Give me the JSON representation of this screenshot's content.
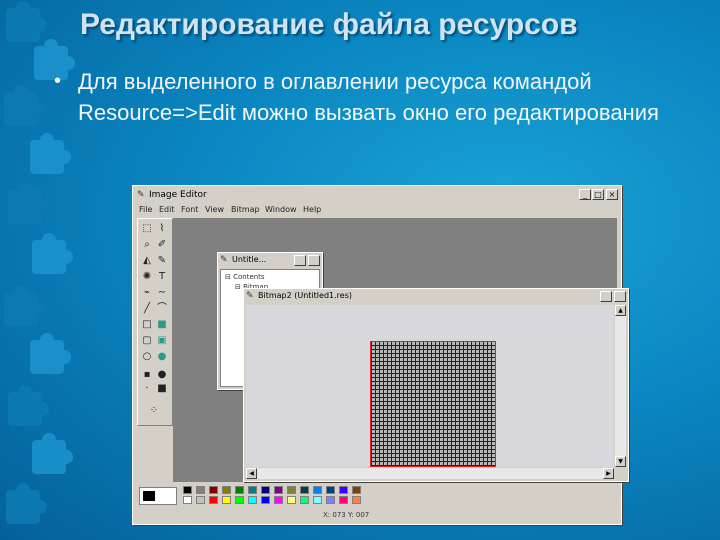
{
  "slide": {
    "title": "Редактирование файла ресурсов",
    "bullet_marker": "•",
    "bullet_text": "Для выделенного в оглавлении ресурса командой Resource=>Edit можно вызвать окно его редактирования"
  },
  "window": {
    "title": "Image Editor",
    "minimize": "_",
    "maximize": "□",
    "close": "×",
    "menu": [
      "File",
      "Edit",
      "Font",
      "View",
      "Bitmap",
      "Window",
      "Help"
    ]
  },
  "tree_window": {
    "title": "Untitle...",
    "items": [
      "⊟ Contents",
      "⊟ Bitmap"
    ]
  },
  "bitmap_window": {
    "title": "Bitmap2 (Untitled1.res)"
  },
  "palette": {
    "colors": [
      "#000000",
      "#808080",
      "#800000",
      "#808000",
      "#008000",
      "#008080",
      "#000080",
      "#800080",
      "#808040",
      "#004040",
      "#0080ff",
      "#004080",
      "#4000ff",
      "#804000",
      "#ffffff",
      "#c0c0c0",
      "#ff0000",
      "#ffff00",
      "#00ff00",
      "#00ffff",
      "#0000ff",
      "#ff00ff",
      "#ffff80",
      "#00ff80",
      "#80ffff",
      "#8080ff",
      "#ff0080",
      "#ff8040"
    ]
  },
  "status": {
    "text": "X: 073 Y: 007"
  }
}
